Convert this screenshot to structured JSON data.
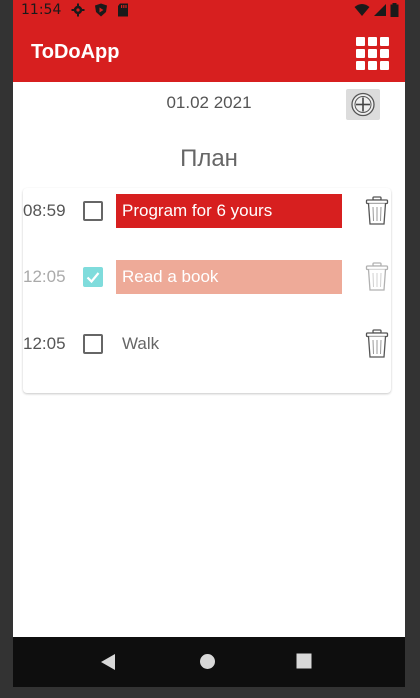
{
  "status_bar": {
    "time": "11:54",
    "icons_left": [
      "gear-icon",
      "shield-play-icon",
      "sd-card-icon"
    ],
    "icons_right": [
      "wifi-icon",
      "cell-signal-icon",
      "battery-icon"
    ],
    "color": "#d71f1f"
  },
  "app_bar": {
    "title": "ToDoApp",
    "menu_icon": "grid-icon",
    "color": "#d71f1f"
  },
  "date_row": {
    "date": "01.02 2021",
    "add_icon": "add-circle-icon"
  },
  "plan": {
    "title": "План"
  },
  "tasks": [
    {
      "time": "08:59",
      "label": "Program for 6 yours",
      "checked": false,
      "style": "active"
    },
    {
      "time": "12:05",
      "label": "Read a book",
      "checked": true,
      "style": "done"
    },
    {
      "time": "12:05",
      "label": "Walk",
      "checked": false,
      "style": "plain"
    }
  ],
  "nav_bar": {
    "buttons": [
      "back-icon",
      "home-icon",
      "recents-icon"
    ]
  }
}
